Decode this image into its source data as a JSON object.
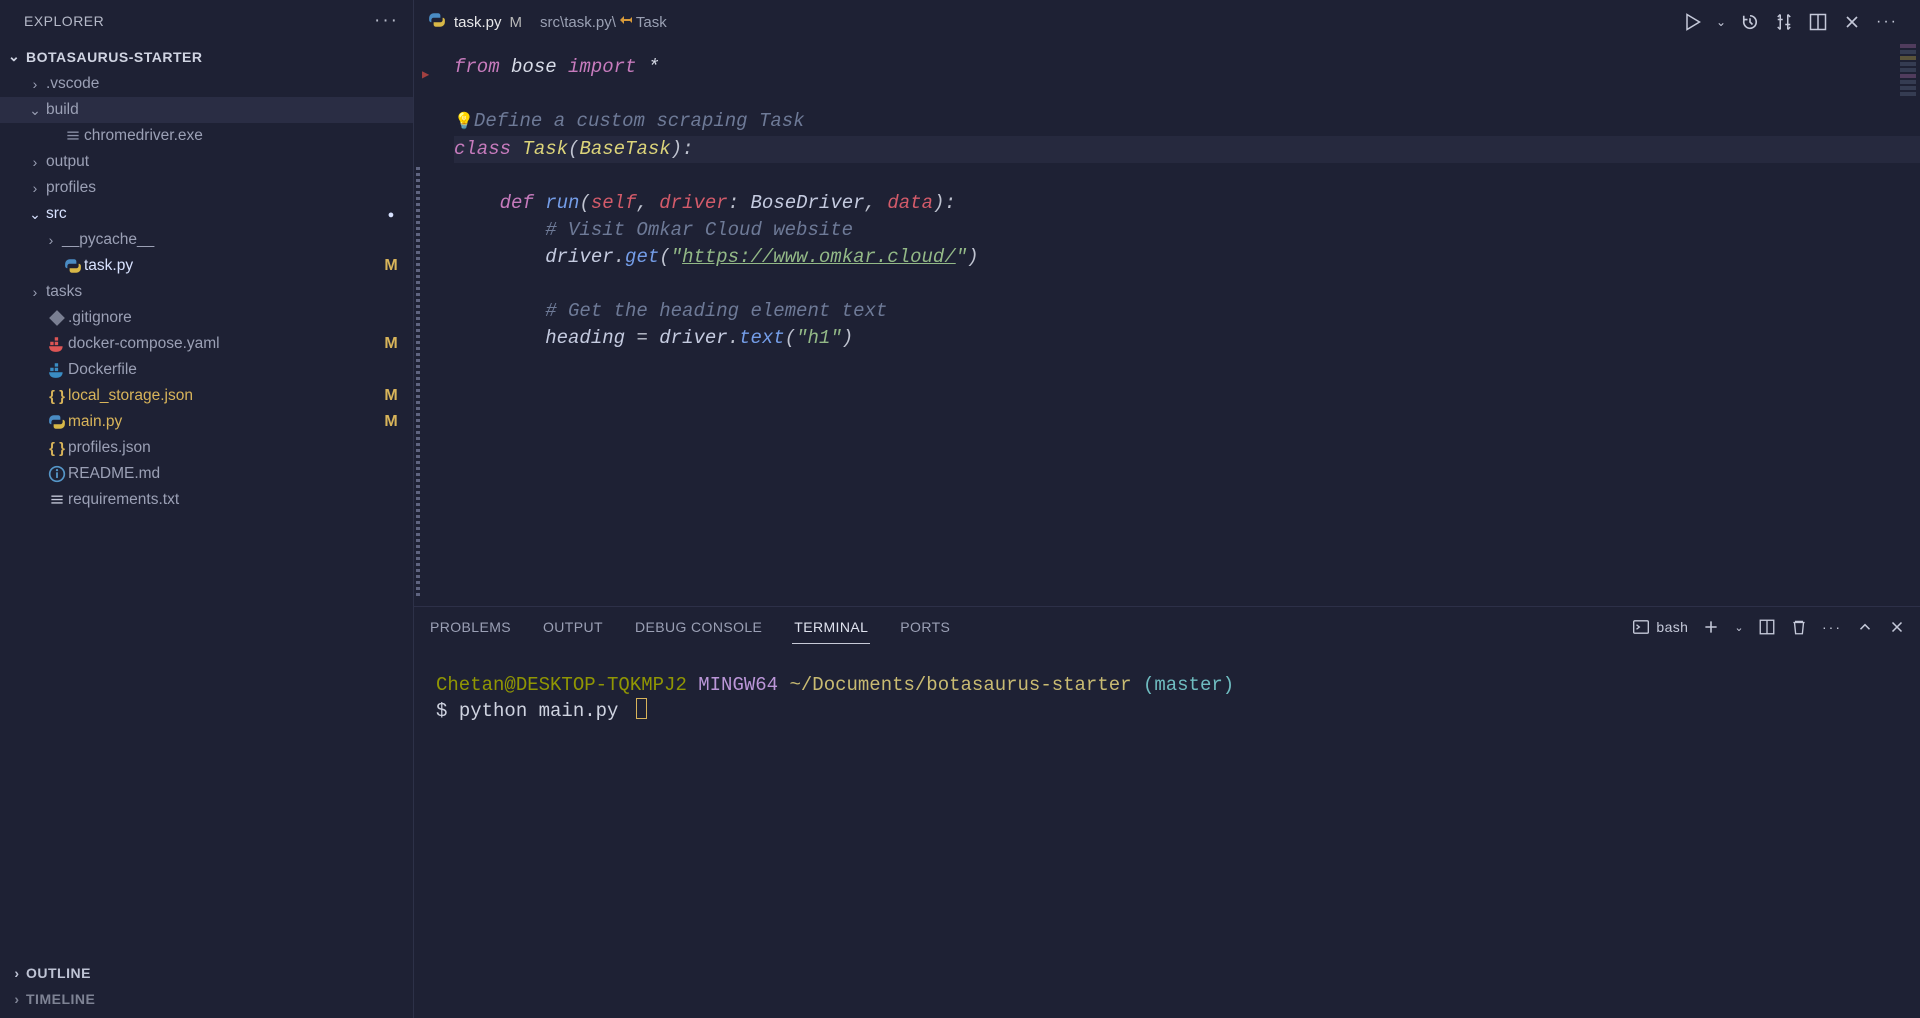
{
  "sidebar": {
    "title": "EXPLORER",
    "project": "BOTASAURUS-STARTER",
    "items": [
      {
        "type": "folder",
        "open": false,
        "depth": 1,
        "label": ".vscode"
      },
      {
        "type": "folder",
        "open": true,
        "depth": 1,
        "label": "build",
        "selected": true
      },
      {
        "type": "file",
        "depth": 2,
        "label": "chromedriver.exe",
        "icon": "lines"
      },
      {
        "type": "folder",
        "open": false,
        "depth": 1,
        "label": "output"
      },
      {
        "type": "folder",
        "open": false,
        "depth": 1,
        "label": "profiles"
      },
      {
        "type": "folder",
        "open": true,
        "depth": 1,
        "label": "src",
        "dot": true,
        "active": true
      },
      {
        "type": "folder",
        "open": false,
        "depth": 2,
        "label": "__pycache__"
      },
      {
        "type": "file",
        "depth": 2,
        "label": "task.py",
        "icon": "python",
        "modified": true,
        "active": true
      },
      {
        "type": "folder",
        "open": false,
        "depth": 1,
        "label": "tasks"
      },
      {
        "type": "file",
        "depth": 1,
        "label": ".gitignore",
        "icon": "git-grey"
      },
      {
        "type": "file",
        "depth": 1,
        "label": "docker-compose.yaml",
        "icon": "docker-red"
      },
      {
        "type": "file",
        "depth": 1,
        "label": "Dockerfile",
        "icon": "docker-blue"
      },
      {
        "type": "file",
        "depth": 1,
        "label": "local_storage.json",
        "icon": "json",
        "modified": true
      },
      {
        "type": "file",
        "depth": 1,
        "label": "main.py",
        "icon": "python",
        "modified": true
      },
      {
        "type": "file",
        "depth": 1,
        "label": "profiles.json",
        "icon": "json"
      },
      {
        "type": "file",
        "depth": 1,
        "label": "README.md",
        "icon": "info"
      },
      {
        "type": "file",
        "depth": 1,
        "label": "requirements.txt",
        "icon": "lines"
      }
    ],
    "footer": [
      "OUTLINE",
      "TIMELINE"
    ]
  },
  "tab": {
    "filename": "task.py",
    "modified_flag": "M",
    "breadcrumb_path": "src\\task.py\\",
    "breadcrumb_symbol": "Task"
  },
  "code": {
    "l1_kw": "from",
    "l1_mod": "bose",
    "l1_imp": "import",
    "l1_star": "*",
    "l2_cmt": "Define a custom scraping Task",
    "l3_kw": "class",
    "l3_name": "Task",
    "l3_base": "BaseTask",
    "l5_kw": "def",
    "l5_name": "run",
    "l5_self": "self",
    "l5_p1": "driver",
    "l5_t1": "BoseDriver",
    "l5_p2": "data",
    "l6_cmt": "# Visit Omkar Cloud website",
    "l7_obj": "driver",
    "l7_fn": "get",
    "l7_url": "https://www.omkar.cloud/",
    "l9_cmt": "# Get the heading element text",
    "l10_var": "heading",
    "l10_obj": "driver",
    "l10_fn": "text",
    "l10_arg": "h1"
  },
  "panel": {
    "tabs": [
      "PROBLEMS",
      "OUTPUT",
      "DEBUG CONSOLE",
      "TERMINAL",
      "PORTS"
    ],
    "active": 3,
    "shell_label": "bash"
  },
  "terminal": {
    "user": "Chetan@DESKTOP-TQKMPJ2",
    "host": "MINGW64",
    "path": "~/Documents/botasaurus-starter",
    "branch": "(master)",
    "prompt_char": "$",
    "command": "python main.py"
  }
}
